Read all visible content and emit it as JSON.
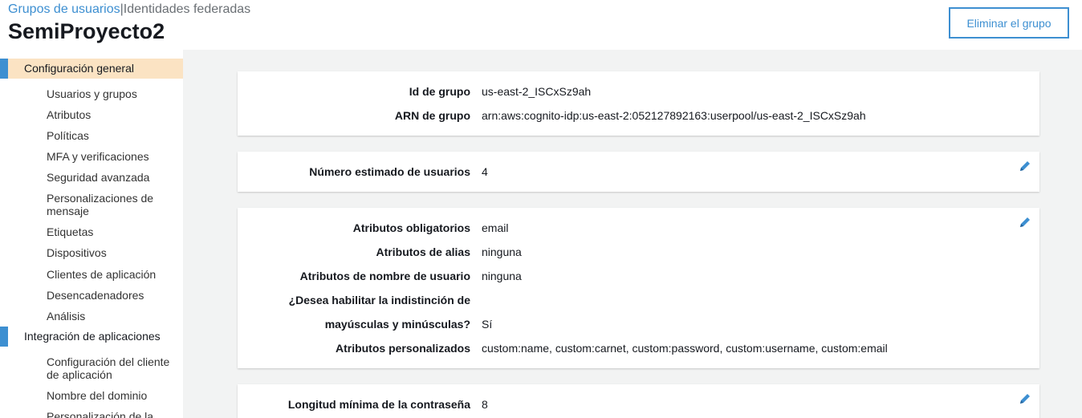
{
  "breadcrumb": {
    "link": "Grupos de usuarios",
    "separator": "|",
    "current": "Identidades federadas"
  },
  "title": "SemiProyecto2",
  "delete_button": "Eliminar el grupo",
  "colors": {
    "accent": "#3d8fd1",
    "active_bg": "#fbe3c3"
  },
  "sidebar": {
    "sections": [
      {
        "label": "Configuración general",
        "items": [
          "Usuarios y grupos",
          "Atributos",
          "Políticas",
          "MFA y verificaciones",
          "Seguridad avanzada",
          "Personalizaciones de mensaje",
          "Etiquetas",
          "Dispositivos",
          "Clientes de aplicación",
          "Desencadenadores",
          "Análisis"
        ]
      },
      {
        "label": "Integración de aplicaciones",
        "items": [
          "Configuración del cliente de aplicación",
          "Nombre del dominio",
          "Personalización de la"
        ]
      }
    ]
  },
  "cards": [
    {
      "rows": [
        {
          "key": "Id de grupo",
          "value": "us-east-2_ISCxSz9ah"
        },
        {
          "key": "ARN de grupo",
          "value": "arn:aws:cognito-idp:us-east-2:052127892163:userpool/us-east-2_ISCxSz9ah"
        }
      ]
    },
    {
      "edit_icon": "pencil-icon",
      "rows": [
        {
          "key": "Número estimado de usuarios",
          "value": "4"
        }
      ]
    },
    {
      "edit_icon": "pencil-icon",
      "rows": [
        {
          "key": "Atributos obligatorios",
          "value": "email"
        },
        {
          "key": "Atributos de alias",
          "value": "ninguna"
        },
        {
          "key": "Atributos de nombre de usuario",
          "value": "ninguna"
        },
        {
          "key": "¿Desea habilitar la indistinción de",
          "value": ""
        },
        {
          "key": "mayúsculas y minúsculas?",
          "value": "Sí"
        },
        {
          "key": "Atributos personalizados",
          "value": "custom:name, custom:carnet, custom:password, custom:username, custom:email"
        }
      ]
    },
    {
      "edit_icon": "pencil-icon",
      "rows": [
        {
          "key": "Longitud mínima de la contraseña",
          "value": "8"
        }
      ]
    }
  ]
}
